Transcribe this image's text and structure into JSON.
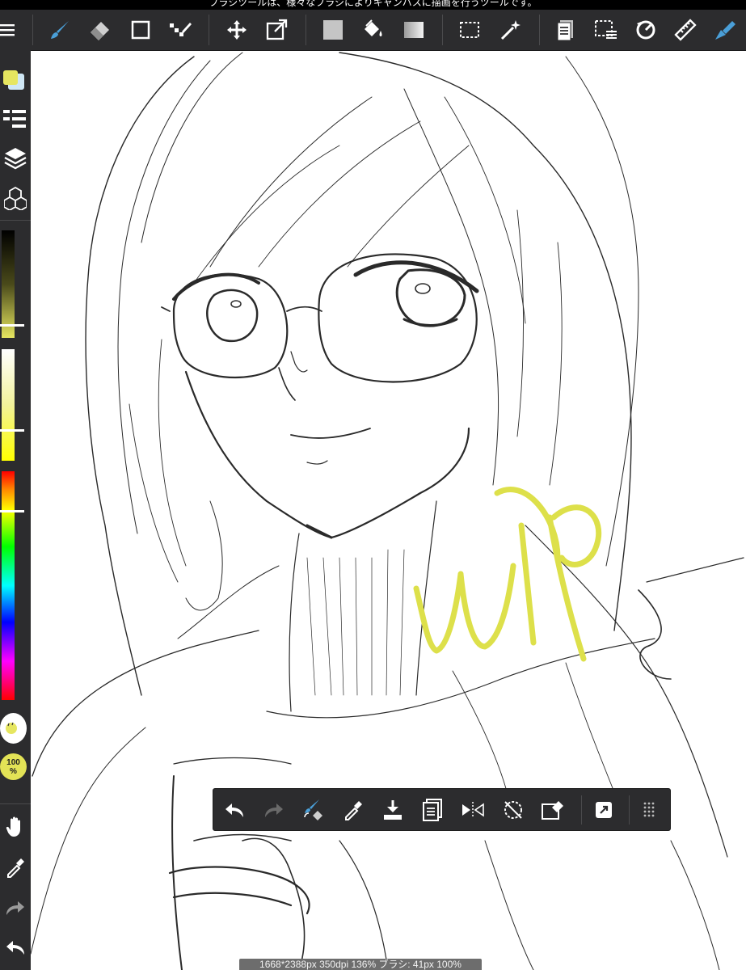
{
  "hint": {
    "text": "ブラシツールは、様々なブラシによりキャンバスに描画を行うツールです。"
  },
  "toolbar": {
    "items": [
      {
        "name": "brush-tool",
        "icon": "brush-icon"
      },
      {
        "name": "eraser-tool",
        "icon": "eraser-icon"
      },
      {
        "name": "object-tool",
        "icon": "square-outline-icon"
      },
      {
        "name": "dot-tool",
        "icon": "dot-pen-icon"
      },
      {
        "name": "move-tool",
        "icon": "move-arrows-icon"
      },
      {
        "name": "transform-tool",
        "icon": "transform-icon"
      },
      {
        "name": "fill-color",
        "icon": "color-swatch-icon"
      },
      {
        "name": "bucket-tool",
        "icon": "paint-bucket-icon"
      },
      {
        "name": "gradient-tool",
        "icon": "gradient-icon"
      },
      {
        "name": "select-tool",
        "icon": "marquee-icon"
      },
      {
        "name": "magic-wand-tool",
        "icon": "magic-wand-icon"
      },
      {
        "name": "material-panel",
        "icon": "material-icon"
      },
      {
        "name": "selection-layer",
        "icon": "selection-layer-icon"
      },
      {
        "name": "rotate-tool",
        "icon": "rotate-icon"
      },
      {
        "name": "ruler-tool",
        "icon": "ruler-icon"
      },
      {
        "name": "quick-access",
        "icon": "quick-access-icon"
      }
    ],
    "accent": "#4a9fd8"
  },
  "colors": {
    "primary": "#e6e660",
    "secondary": "#cfe7f5",
    "wip": "#dde04a",
    "line": "#1a1a1a"
  },
  "sidebar": {
    "brush_opacity": "100\n%",
    "opacity_line1": "100",
    "opacity_line2": "%"
  },
  "sliders": {
    "value_level": 0.87,
    "saturation_level": 0.72,
    "hue_level": 0.17
  },
  "float_bar": {
    "items": [
      "undo",
      "redo",
      "brush-eraser-toggle",
      "eyedropper",
      "save-download",
      "copy",
      "flip-horizontal",
      "rotate-reset",
      "clear",
      "transform",
      "drag-handle"
    ]
  },
  "canvas": {
    "watermark": "WIP"
  },
  "status": {
    "text": "1668*2388px 350dpi 136% ブラシ: 41px 100%"
  }
}
